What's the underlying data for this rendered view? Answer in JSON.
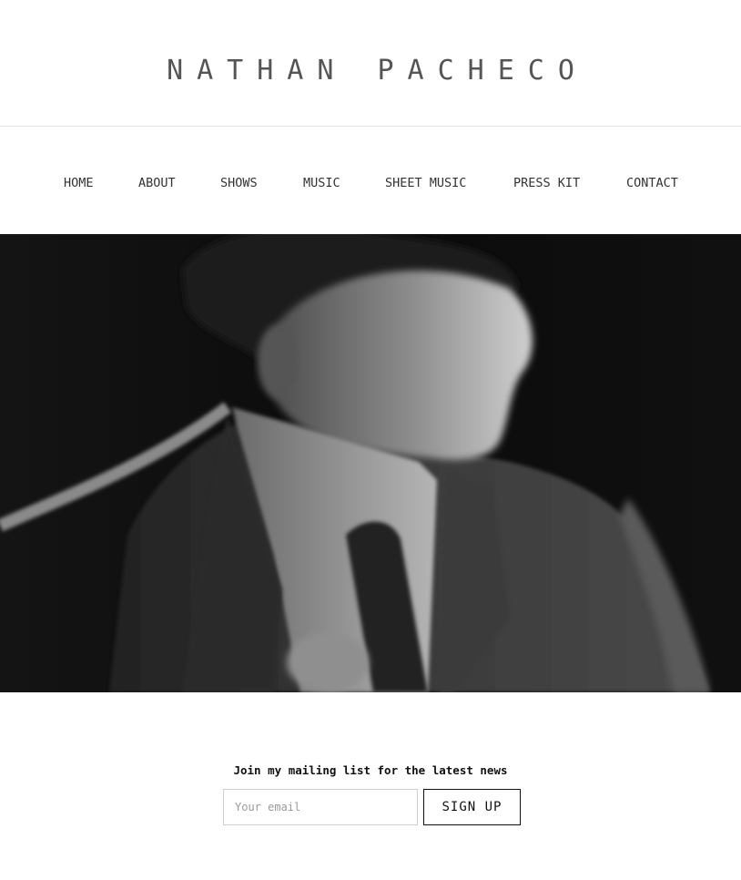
{
  "header": {
    "site_title": "NATHAN PACHECO"
  },
  "nav": {
    "items": [
      {
        "label": "HOME"
      },
      {
        "label": "ABOUT"
      },
      {
        "label": "SHOWS"
      },
      {
        "label": "MUSIC"
      },
      {
        "label": "SHEET MUSIC"
      },
      {
        "label": "PRESS KIT"
      },
      {
        "label": "CONTACT"
      }
    ]
  },
  "hero": {
    "icon": "portrait-photo"
  },
  "signup": {
    "label": "Join my mailing list for the latest news",
    "email_placeholder": "Your email",
    "email_value": "",
    "button_label": "SIGN UP"
  }
}
